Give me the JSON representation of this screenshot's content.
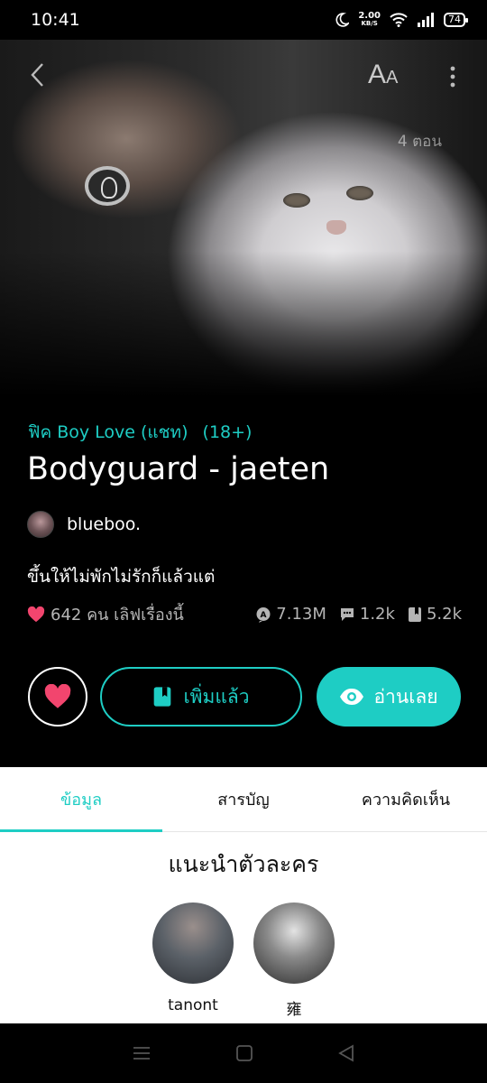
{
  "status_bar": {
    "time": "10:41",
    "network_speed": "2.00",
    "network_unit": "KB/S",
    "battery": "74"
  },
  "hero": {
    "episodes": "4 ตอน"
  },
  "story": {
    "genre": "ฟิค Boy Love (แชท)",
    "rating": "(18+)",
    "title": "Bodyguard - jaeten",
    "author": "blueboo.",
    "tagline": "ขึ้นให้ไม่พักไม่รักก็แล้วแต่",
    "likes_text": "642 คน เลิฟเรื่องนี้",
    "views": "7.13M",
    "comments": "1.2k",
    "bookmarks": "5.2k"
  },
  "actions": {
    "added_label": "เพิ่มแล้ว",
    "read_label": "อ่านเลย"
  },
  "tabs": [
    {
      "label": "ข้อมูล",
      "active": true
    },
    {
      "label": "สารบัญ",
      "active": false
    },
    {
      "label": "ความคิดเห็น",
      "active": false
    }
  ],
  "characters_section": {
    "title": "แนะนำตัวละคร",
    "characters": [
      {
        "name": "tanont"
      },
      {
        "name": "雍"
      }
    ]
  },
  "colors": {
    "accent": "#1ecdc4",
    "heart": "#f2456e"
  },
  "icons": [
    "back-icon",
    "font-size-icon",
    "more-icon",
    "heart-icon",
    "views-icon",
    "comment-icon",
    "bookmark-icon",
    "eye-icon"
  ]
}
